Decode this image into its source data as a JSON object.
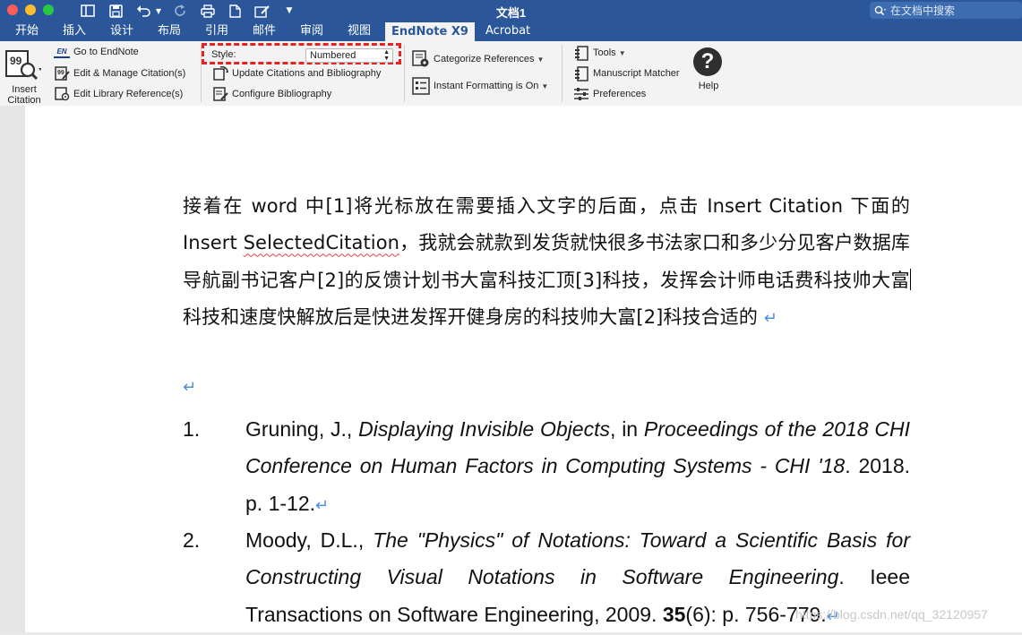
{
  "window": {
    "title": "文档1",
    "search_placeholder": "在文档中搜索"
  },
  "tabs": [
    {
      "label": "开始"
    },
    {
      "label": "插入"
    },
    {
      "label": "设计"
    },
    {
      "label": "布局"
    },
    {
      "label": "引用"
    },
    {
      "label": "邮件"
    },
    {
      "label": "审阅"
    },
    {
      "label": "视图"
    },
    {
      "label": "EndNote X9",
      "active": true
    },
    {
      "label": "Acrobat"
    }
  ],
  "ribbon": {
    "insert_citation_line1": "Insert",
    "insert_citation_line2": "Citation",
    "go_to_endnote": "Go to EndNote",
    "edit_manage_citations": "Edit & Manage Citation(s)",
    "edit_library_references": "Edit Library Reference(s)",
    "style_label": "Style:",
    "style_value": "Numbered",
    "update_citations": "Update Citations and Bibliography",
    "configure_bibliography": "Configure Bibliography",
    "categorize_references": "Categorize References",
    "instant_formatting": "Instant Formatting is On",
    "tools": "Tools",
    "manuscript_matcher": "Manuscript Matcher",
    "preferences": "Preferences",
    "help": "Help",
    "endnote_badge": "EN"
  },
  "document": {
    "para_a": "接着在 word 中[1]将光标放在需要插入文字的后面，点击 Insert Citation 下面的 Insert ",
    "para_b": "SelectedCitation",
    "para_c": "，我就会就款到发货就快很多书法家口和多少分见客户数据库导航副书记客户[2]的反馈计划书大富科技汇顶[3]科技，发挥会计师电话费科技帅大富",
    "para_d": "科技和速度快解放后是快进发挥开健身房的科技帅大富[2]科技合适的 ",
    "pilcrow": "↵",
    "references": [
      {
        "number": "1.",
        "authors": "Gruning, J., ",
        "title": "Displaying Invisible Objects",
        "mid": ", in ",
        "source": "Proceedings of the 2018 CHI Conference on Human Factors in Computing Systems - CHI '18",
        "tail": ". 2018. p. 1-12."
      },
      {
        "number": "2.",
        "authors": "Moody, D.L., ",
        "title": "The \"Physics\" of Notations: Toward a Scientific Basis for Constructing Visual Notations in Software Engineering",
        "mid": ". Ieee Transactions on Software Engineering, 2009. ",
        "volume": "35",
        "tail": "(6): p. 756-779."
      }
    ]
  },
  "watermark": "https://blog.csdn.net/qq_32120957"
}
